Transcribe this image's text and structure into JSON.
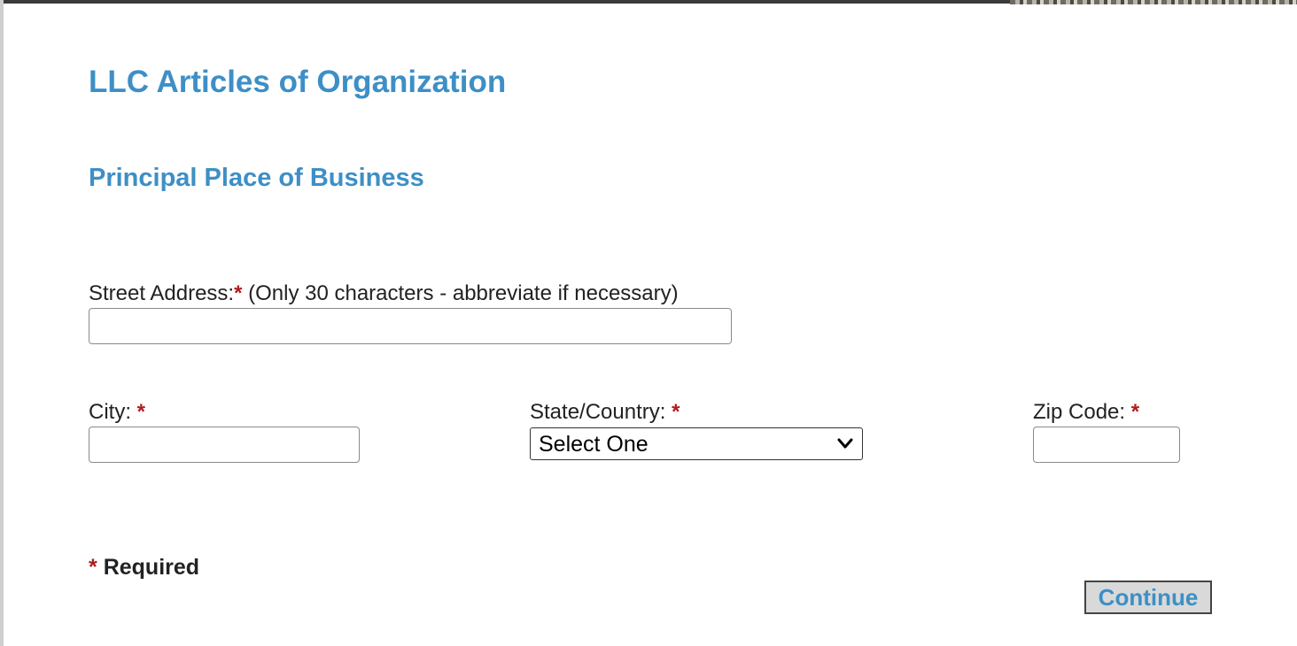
{
  "header": {
    "page_title": "LLC Articles of Organization",
    "section_title": "Principal Place of Business"
  },
  "form": {
    "required_marker": "*",
    "street": {
      "label": "Street Address:",
      "note": "(Only 30 characters - abbreviate if necessary)",
      "value": "",
      "maxlength": "30"
    },
    "city": {
      "label": "City:",
      "value": ""
    },
    "state": {
      "label": "State/Country:",
      "selected": "Select One"
    },
    "zip": {
      "label": "Zip Code:",
      "value": ""
    }
  },
  "footer": {
    "required_text": "Required",
    "continue_label": "Continue"
  },
  "colors": {
    "heading": "#3d8fc6",
    "required_star": "#b01c1c",
    "button_bg": "#d9d9d9",
    "button_text": "#3d8fc6"
  }
}
